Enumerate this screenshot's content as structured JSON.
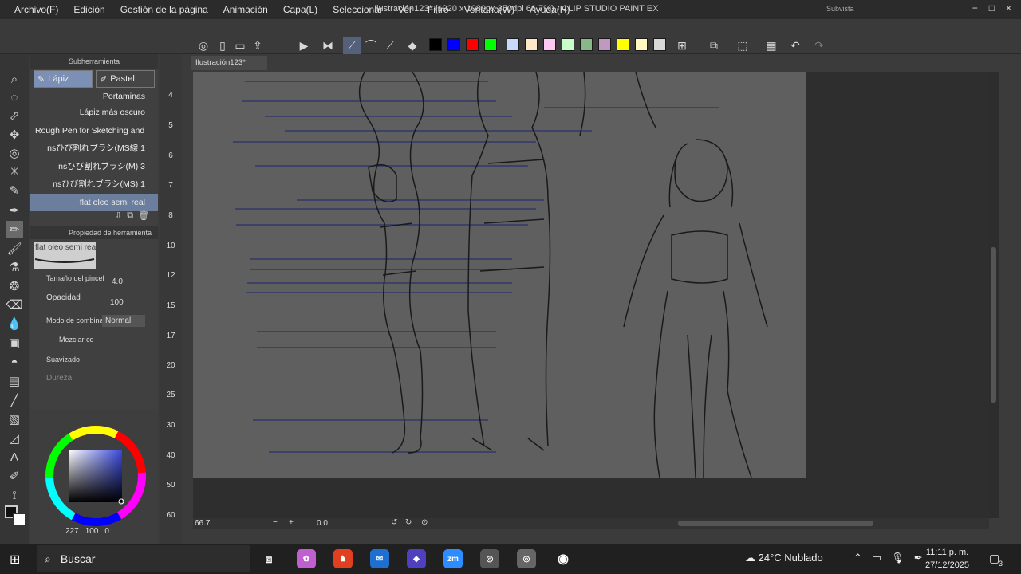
{
  "app": {
    "window_title": "Ilustración123* (1920 x 1080px 350dpi 66.7%) - CLIP STUDIO PAINT EX",
    "subvista": "Subvista",
    "menu": [
      "Archivo(F)",
      "Edición",
      "Gestión de la página",
      "Animación",
      "Capa(L)",
      "Seleccionar",
      "Ver",
      "Filtro",
      "Ventana(W)",
      "Ayuda(H)"
    ],
    "win_controls": [
      "−",
      "□",
      "×"
    ]
  },
  "toolbar": {
    "colors": [
      "#000000",
      "#0000ff",
      "#ff0000",
      "#00ff00",
      "#c8d8ff",
      "#ffe8c8",
      "#ffc8f0",
      "#c8ffc8",
      "#88b888",
      "#c098c0",
      "#ffff00",
      "#fff8c0",
      "#d8d8d8"
    ]
  },
  "subtool": {
    "header": "Subherramienta",
    "tabs": [
      "Lápiz",
      "Pastel"
    ],
    "brushes": [
      "Portaminas",
      "Lápiz más oscuro",
      "Rough Pen for Sketching and",
      "nsひび割れブラシ(MS線 1",
      "nsひび割れブラシ(M) 3",
      "nsひび割れブラシ(MS) 1",
      "flat oleo semi real"
    ],
    "selected_brush": "flat oleo semi real"
  },
  "tool_property": {
    "header": "Propiedad de herramienta",
    "preview_label": "flat oleo semi real",
    "brush_size_label": "Tamaño del pincel",
    "brush_size_value": "4.0",
    "opacity_label": "Opacidad",
    "opacity_value": "100",
    "blend_label": "Modo de combinac",
    "blend_value": "Normal",
    "mix_label": "Mezclar co",
    "smoothing_label": "Suavizado",
    "hardness_label": "Dureza"
  },
  "brush_sizes": [
    "4",
    "5",
    "6",
    "7",
    "8",
    "10",
    "12",
    "15",
    "17",
    "20",
    "25",
    "30",
    "40",
    "50",
    "60"
  ],
  "color": {
    "values": [
      "227",
      "100",
      "0"
    ]
  },
  "document": {
    "tab": "Ilustración123*"
  },
  "status": {
    "zoom": "66.7",
    "angle": "0.0"
  },
  "taskbar": {
    "search_placeholder": "Buscar",
    "weather_temp": "24°C",
    "weather_desc": "Nublado",
    "time": "11:11 p. m.",
    "date": "27/12/2025",
    "notif_count": "3"
  }
}
